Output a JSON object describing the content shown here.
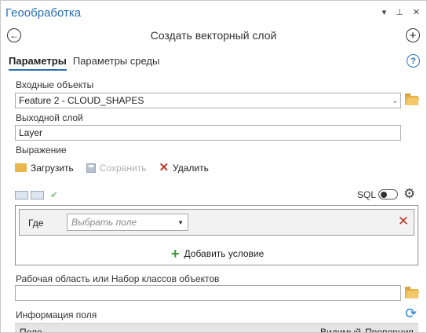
{
  "pane": {
    "title": "Геообработка",
    "controls": [
      "▾",
      "⊥",
      "✕"
    ]
  },
  "tool": {
    "title": "Создать векторный слой"
  },
  "tabs": [
    {
      "label": "Параметры",
      "active": true
    },
    {
      "label": "Параметры среды",
      "active": false
    }
  ],
  "input_features": {
    "label": "Входные объекты",
    "value": "Feature 2 - CLOUD_SHAPES"
  },
  "output_layer": {
    "label": "Выходной слой",
    "value": "Layer"
  },
  "expression": {
    "label": "Выражение",
    "load": "Загрузить",
    "save": "Сохранить",
    "delete": "Удалить",
    "sql_label": "SQL",
    "clause": {
      "where_label": "Где",
      "field_placeholder": "Выбрать поле",
      "add_condition": "Добавить условие"
    }
  },
  "workspace": {
    "label": "Рабочая область или Набор классов объектов",
    "value": ""
  },
  "field_info": {
    "label": "Информация поля",
    "columns": [
      "Поле",
      "Видимый",
      "Пропорция"
    ]
  },
  "colors": {
    "accent": "#2a6fb5",
    "delete": "#c0392b",
    "add": "#3a9a3a"
  }
}
